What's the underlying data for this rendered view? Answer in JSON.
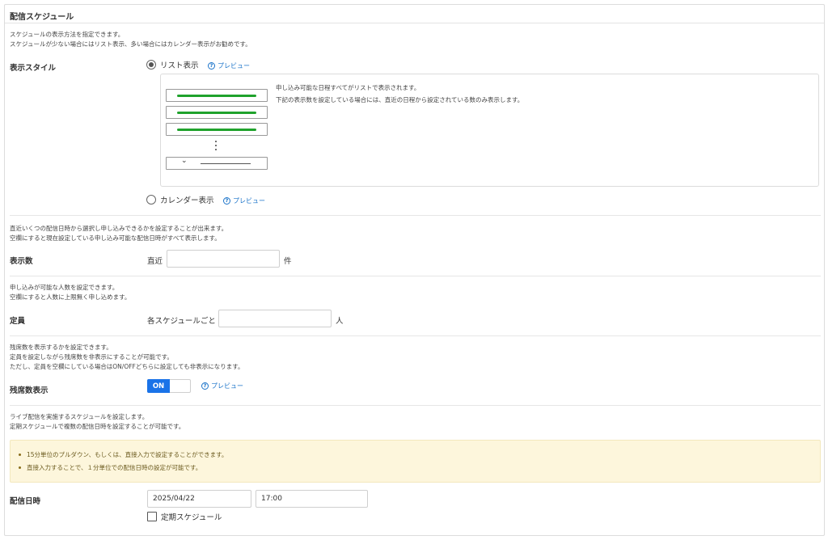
{
  "panel": {
    "title": "配信スケジュール"
  },
  "display_style": {
    "note_lines": [
      "スケジュールの表示方法を指定できます。",
      "スケジュールが少ない場合にはリスト表示、多い場合にはカレンダー表示がお勧めです。"
    ],
    "label": "表示スタイル",
    "option_list": {
      "label": "リスト表示",
      "selected": true
    },
    "option_calendar": {
      "label": "カレンダー表示",
      "selected": false
    },
    "preview_label": "プレビュー",
    "help_glyph": "?",
    "preview_desc_lines": [
      "申し込み可能な日程すべてがリストで表示されます。",
      "下記の表示数を設定している場合には、直近の日程から設定されている数のみ表示します。"
    ],
    "preview_row_count": 3,
    "dropdown_glyph": "⌄"
  },
  "display_count": {
    "note_lines": [
      "直近いくつの配信日時から選択し申し込みできるかを設定することが出来ます。",
      "空欄にすると現在設定している申し込み可能な配信日時がすべて表示します。"
    ],
    "label": "表示数",
    "prefix": "直近",
    "value": "",
    "suffix": "件"
  },
  "capacity": {
    "note_lines": [
      "申し込みが可能な人数を設定できます。",
      "空欄にすると人数に上限無く申し込めます。"
    ],
    "label": "定員",
    "prefix": "各スケジュールごと",
    "value": "",
    "suffix": "人"
  },
  "remaining_seats": {
    "note_lines": [
      "残席数を表示するかを設定できます。",
      "定員を設定しながら残席数を非表示にすることが可能です。",
      "ただし、定員を空欄にしている場合はON/OFFどちらに設定しても非表示になります。"
    ],
    "label": "残席数表示",
    "toggle_label": "ON",
    "toggle_on": true,
    "preview_label": "プレビュー"
  },
  "schedule": {
    "note_lines": [
      "ライブ配信を実施するスケジュールを設定します。",
      "定期スケジュールで複数の配信日時を設定することが可能です。"
    ],
    "warnings": [
      "15分単位のプルダウン、もしくは、直接入力で設定することができます。",
      "直接入力することで、１分単位での配信日時の設定が可能です。"
    ],
    "label": "配信日時",
    "date_value": "2025/04/22",
    "time_value": "17:00",
    "recurring_label": "定期スケジュール",
    "recurring_checked": false
  }
}
